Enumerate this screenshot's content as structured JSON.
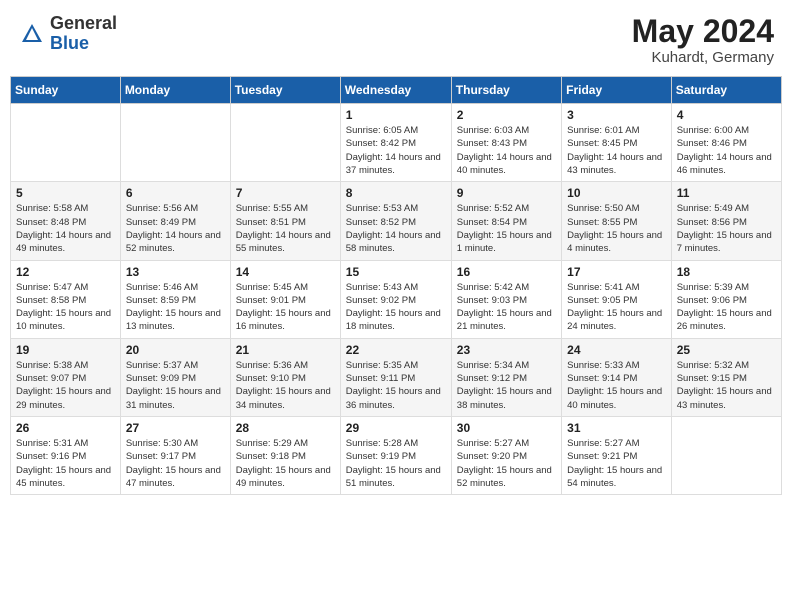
{
  "logo": {
    "general": "General",
    "blue": "Blue"
  },
  "title": "May 2024",
  "subtitle": "Kuhardt, Germany",
  "days_of_week": [
    "Sunday",
    "Monday",
    "Tuesday",
    "Wednesday",
    "Thursday",
    "Friday",
    "Saturday"
  ],
  "weeks": [
    [
      {
        "num": "",
        "info": ""
      },
      {
        "num": "",
        "info": ""
      },
      {
        "num": "",
        "info": ""
      },
      {
        "num": "1",
        "info": "Sunrise: 6:05 AM\nSunset: 8:42 PM\nDaylight: 14 hours\nand 37 minutes."
      },
      {
        "num": "2",
        "info": "Sunrise: 6:03 AM\nSunset: 8:43 PM\nDaylight: 14 hours\nand 40 minutes."
      },
      {
        "num": "3",
        "info": "Sunrise: 6:01 AM\nSunset: 8:45 PM\nDaylight: 14 hours\nand 43 minutes."
      },
      {
        "num": "4",
        "info": "Sunrise: 6:00 AM\nSunset: 8:46 PM\nDaylight: 14 hours\nand 46 minutes."
      }
    ],
    [
      {
        "num": "5",
        "info": "Sunrise: 5:58 AM\nSunset: 8:48 PM\nDaylight: 14 hours\nand 49 minutes."
      },
      {
        "num": "6",
        "info": "Sunrise: 5:56 AM\nSunset: 8:49 PM\nDaylight: 14 hours\nand 52 minutes."
      },
      {
        "num": "7",
        "info": "Sunrise: 5:55 AM\nSunset: 8:51 PM\nDaylight: 14 hours\nand 55 minutes."
      },
      {
        "num": "8",
        "info": "Sunrise: 5:53 AM\nSunset: 8:52 PM\nDaylight: 14 hours\nand 58 minutes."
      },
      {
        "num": "9",
        "info": "Sunrise: 5:52 AM\nSunset: 8:54 PM\nDaylight: 15 hours\nand 1 minute."
      },
      {
        "num": "10",
        "info": "Sunrise: 5:50 AM\nSunset: 8:55 PM\nDaylight: 15 hours\nand 4 minutes."
      },
      {
        "num": "11",
        "info": "Sunrise: 5:49 AM\nSunset: 8:56 PM\nDaylight: 15 hours\nand 7 minutes."
      }
    ],
    [
      {
        "num": "12",
        "info": "Sunrise: 5:47 AM\nSunset: 8:58 PM\nDaylight: 15 hours\nand 10 minutes."
      },
      {
        "num": "13",
        "info": "Sunrise: 5:46 AM\nSunset: 8:59 PM\nDaylight: 15 hours\nand 13 minutes."
      },
      {
        "num": "14",
        "info": "Sunrise: 5:45 AM\nSunset: 9:01 PM\nDaylight: 15 hours\nand 16 minutes."
      },
      {
        "num": "15",
        "info": "Sunrise: 5:43 AM\nSunset: 9:02 PM\nDaylight: 15 hours\nand 18 minutes."
      },
      {
        "num": "16",
        "info": "Sunrise: 5:42 AM\nSunset: 9:03 PM\nDaylight: 15 hours\nand 21 minutes."
      },
      {
        "num": "17",
        "info": "Sunrise: 5:41 AM\nSunset: 9:05 PM\nDaylight: 15 hours\nand 24 minutes."
      },
      {
        "num": "18",
        "info": "Sunrise: 5:39 AM\nSunset: 9:06 PM\nDaylight: 15 hours\nand 26 minutes."
      }
    ],
    [
      {
        "num": "19",
        "info": "Sunrise: 5:38 AM\nSunset: 9:07 PM\nDaylight: 15 hours\nand 29 minutes."
      },
      {
        "num": "20",
        "info": "Sunrise: 5:37 AM\nSunset: 9:09 PM\nDaylight: 15 hours\nand 31 minutes."
      },
      {
        "num": "21",
        "info": "Sunrise: 5:36 AM\nSunset: 9:10 PM\nDaylight: 15 hours\nand 34 minutes."
      },
      {
        "num": "22",
        "info": "Sunrise: 5:35 AM\nSunset: 9:11 PM\nDaylight: 15 hours\nand 36 minutes."
      },
      {
        "num": "23",
        "info": "Sunrise: 5:34 AM\nSunset: 9:12 PM\nDaylight: 15 hours\nand 38 minutes."
      },
      {
        "num": "24",
        "info": "Sunrise: 5:33 AM\nSunset: 9:14 PM\nDaylight: 15 hours\nand 40 minutes."
      },
      {
        "num": "25",
        "info": "Sunrise: 5:32 AM\nSunset: 9:15 PM\nDaylight: 15 hours\nand 43 minutes."
      }
    ],
    [
      {
        "num": "26",
        "info": "Sunrise: 5:31 AM\nSunset: 9:16 PM\nDaylight: 15 hours\nand 45 minutes."
      },
      {
        "num": "27",
        "info": "Sunrise: 5:30 AM\nSunset: 9:17 PM\nDaylight: 15 hours\nand 47 minutes."
      },
      {
        "num": "28",
        "info": "Sunrise: 5:29 AM\nSunset: 9:18 PM\nDaylight: 15 hours\nand 49 minutes."
      },
      {
        "num": "29",
        "info": "Sunrise: 5:28 AM\nSunset: 9:19 PM\nDaylight: 15 hours\nand 51 minutes."
      },
      {
        "num": "30",
        "info": "Sunrise: 5:27 AM\nSunset: 9:20 PM\nDaylight: 15 hours\nand 52 minutes."
      },
      {
        "num": "31",
        "info": "Sunrise: 5:27 AM\nSunset: 9:21 PM\nDaylight: 15 hours\nand 54 minutes."
      },
      {
        "num": "",
        "info": ""
      }
    ]
  ]
}
